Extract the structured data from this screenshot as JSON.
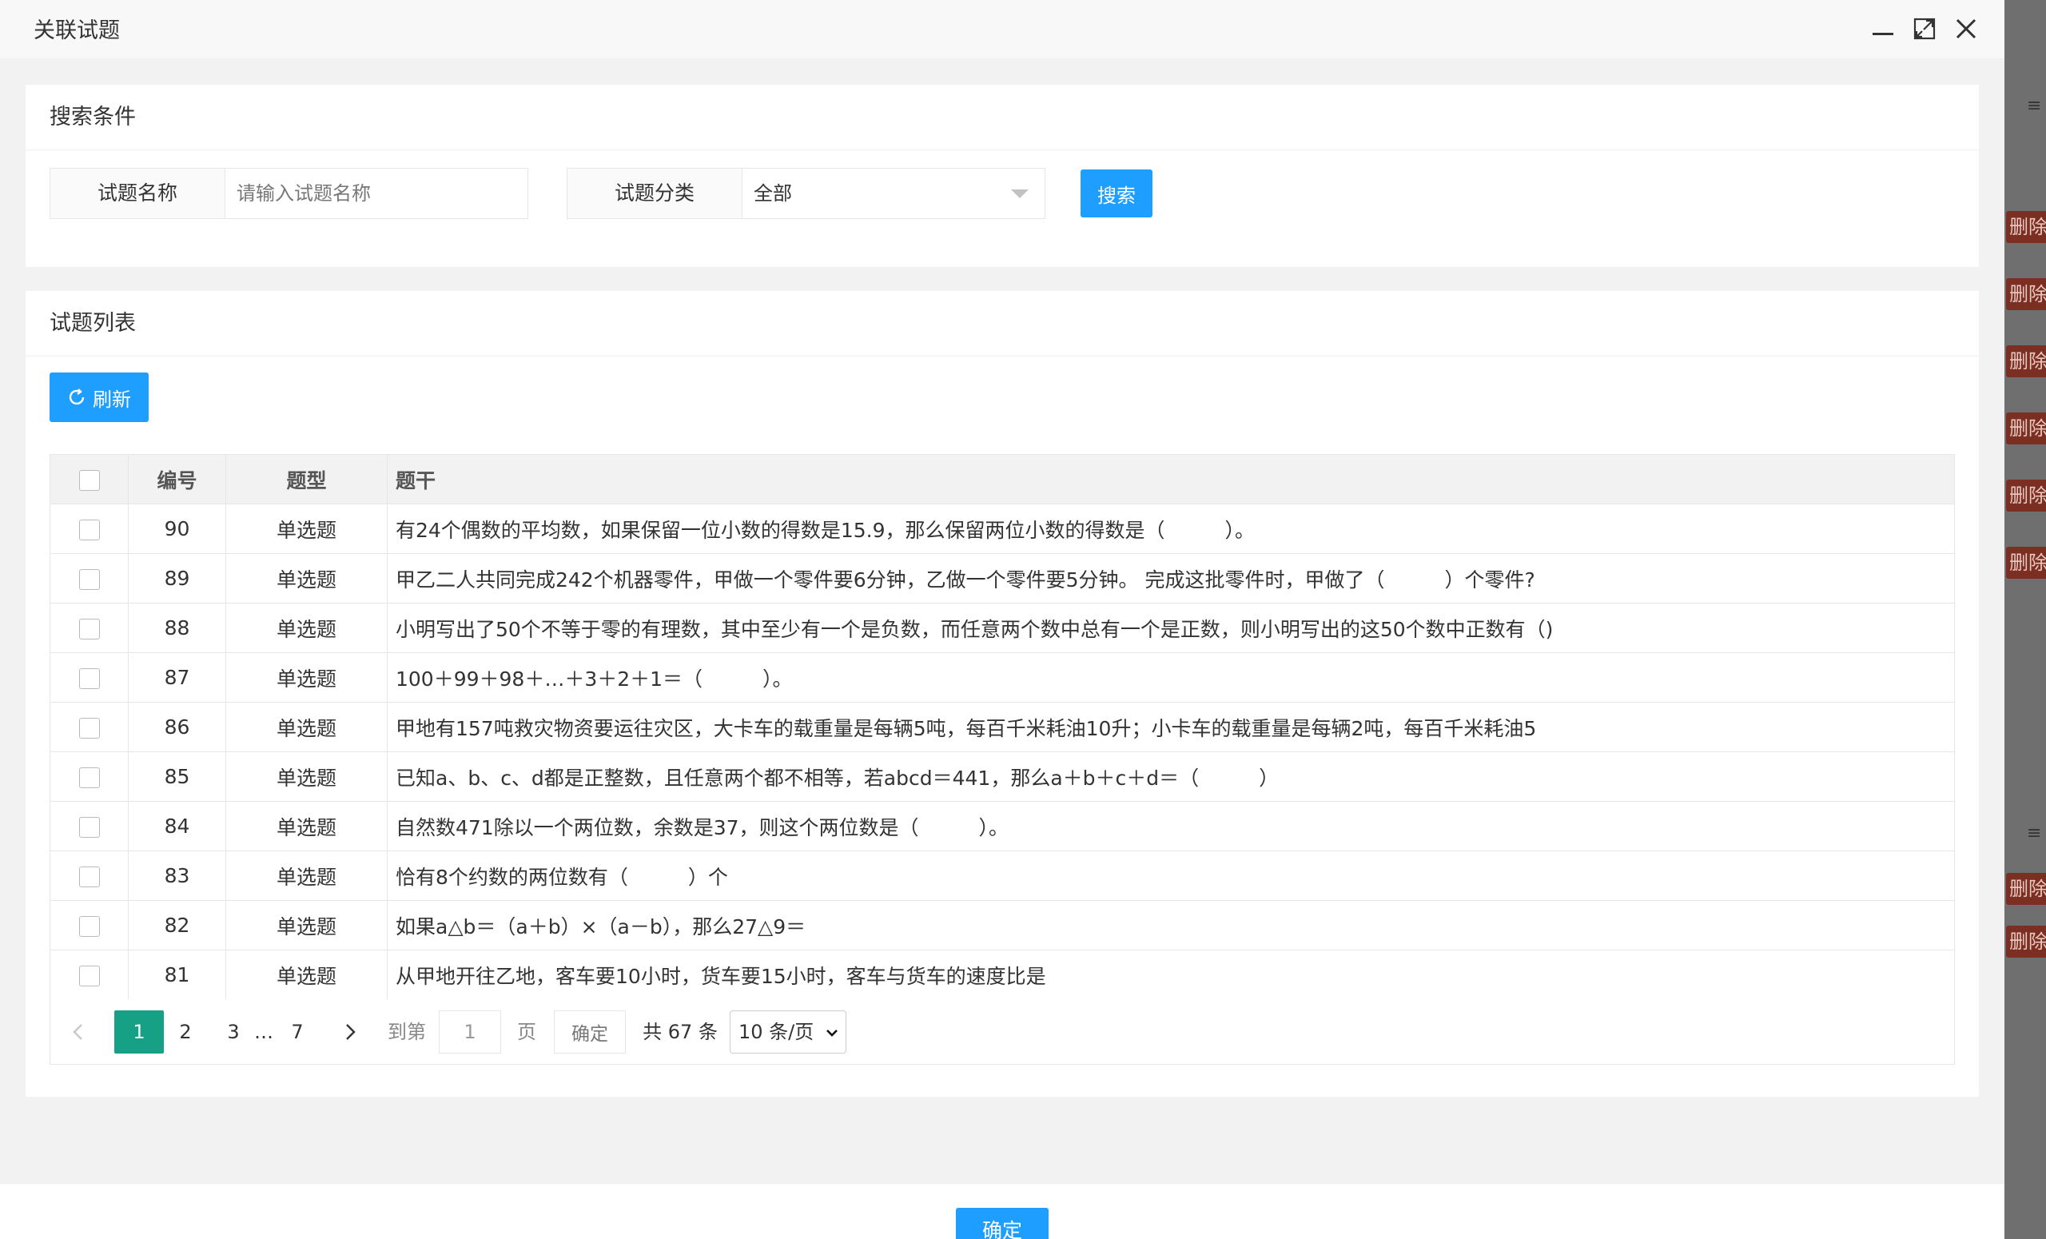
{
  "modal": {
    "title": "关联试题",
    "confirm_label": "确定"
  },
  "search": {
    "header": "搜索条件",
    "name_label": "试题名称",
    "name_placeholder": "请输入试题名称",
    "name_value": "",
    "category_label": "试题分类",
    "category_value": "全部",
    "search_button": "搜索"
  },
  "list": {
    "header": "试题列表",
    "refresh_button": "刷新",
    "columns": [
      "编号",
      "题型",
      "题干"
    ],
    "rows": [
      {
        "id": "90",
        "type": "单选题",
        "stem": "有24个偶数的平均数，如果保留一位小数的得数是15.9，那么保留两位小数的得数是（　　　）。"
      },
      {
        "id": "89",
        "type": "单选题",
        "stem": "甲乙二人共同完成242个机器零件，甲做一个零件要6分钟，乙做一个零件要5分钟。 完成这批零件时，甲做了（　　　）个零件?"
      },
      {
        "id": "88",
        "type": "单选题",
        "stem": "小明写出了50个不等于零的有理数，其中至少有一个是负数，而任意两个数中总有一个是正数，则小明写出的这50个数中正数有（)"
      },
      {
        "id": "87",
        "type": "单选题",
        "stem": "100＋99＋98＋…＋3＋2＋1＝（　　　）。"
      },
      {
        "id": "86",
        "type": "单选题",
        "stem": "甲地有157吨救灾物资要运往灾区，大卡车的载重量是每辆5吨，每百千米耗油10升；小卡车的载重量是每辆2吨，每百千米耗油5"
      },
      {
        "id": "85",
        "type": "单选题",
        "stem": "已知a、b、c、d都是正整数，且任意两个都不相等，若abcd＝441，那么a＋b＋c＋d＝（　　　）"
      },
      {
        "id": "84",
        "type": "单选题",
        "stem": "自然数471除以一个两位数，余数是37，则这个两位数是（　　　）。"
      },
      {
        "id": "83",
        "type": "单选题",
        "stem": "恰有8个约数的两位数有（　　　）个"
      },
      {
        "id": "82",
        "type": "单选题",
        "stem": "如果a△b＝（a＋b）×（a－b），那么27△9＝"
      },
      {
        "id": "81",
        "type": "单选题",
        "stem": "从甲地开往乙地，客车要10小时，货车要15小时，客车与货车的速度比是"
      }
    ]
  },
  "pager": {
    "pages": [
      "1",
      "2",
      "3"
    ],
    "ellipsis": "…",
    "last_page": "7",
    "goto_label": "到第",
    "goto_value": "1",
    "page_unit": "页",
    "ok_label": "确定",
    "total_text": "共 67 条",
    "page_size": "10 条/页"
  },
  "background": {
    "delete_label": "删除"
  },
  "colors": {
    "primary": "#1E9FFF",
    "pager_active": "#16a085"
  }
}
